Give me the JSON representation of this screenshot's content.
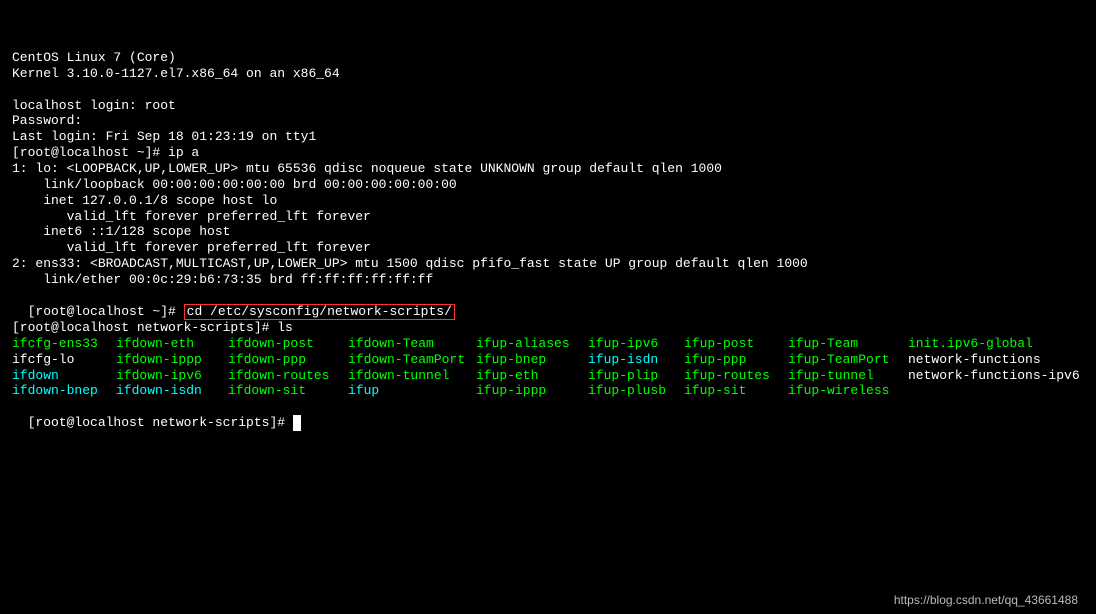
{
  "header": {
    "os": "CentOS Linux 7 (Core)",
    "kernel": "Kernel 3.10.0-1127.el7.x86_64 on an x86_64"
  },
  "login": {
    "prompt": "localhost login: root",
    "password": "Password:",
    "lastlogin": "Last login: Fri Sep 18 01:23:19 on tty1"
  },
  "cmd1": {
    "prompt": "[root@localhost ~]# ip a"
  },
  "ipa": {
    "l1": "1: lo: <LOOPBACK,UP,LOWER_UP> mtu 65536 qdisc noqueue state UNKNOWN group default qlen 1000",
    "l2": "    link/loopback 00:00:00:00:00:00 brd 00:00:00:00:00:00",
    "l3": "    inet 127.0.0.1/8 scope host lo",
    "l4": "       valid_lft forever preferred_lft forever",
    "l5": "    inet6 ::1/128 scope host",
    "l6": "       valid_lft forever preferred_lft forever",
    "l7": "2: ens33: <BROADCAST,MULTICAST,UP,LOWER_UP> mtu 1500 qdisc pfifo_fast state UP group default qlen 1000",
    "l8": "    link/ether 00:0c:29:b6:73:35 brd ff:ff:ff:ff:ff:ff"
  },
  "cmd2": {
    "prompt": "[root@localhost ~]# ",
    "boxed": "cd /etc/sysconfig/network-scripts/"
  },
  "cmd3": {
    "prompt": "[root@localhost network-scripts]# ls"
  },
  "ls": {
    "r0": {
      "c0": "ifcfg-ens33",
      "c1": "ifdown-eth",
      "c2": "ifdown-post",
      "c3": "ifdown-Team",
      "c4": "ifup-aliases",
      "c5": "ifup-ipv6",
      "c6": "ifup-post",
      "c7": "ifup-Team",
      "c8": "init.ipv6-global"
    },
    "r1": {
      "c0": "ifcfg-lo",
      "c1": "ifdown-ippp",
      "c2": "ifdown-ppp",
      "c3": "ifdown-TeamPort",
      "c4": "ifup-bnep",
      "c5": "ifup-isdn",
      "c6": "ifup-ppp",
      "c7": "ifup-TeamPort",
      "c8": "network-functions"
    },
    "r2": {
      "c0": "ifdown",
      "c1": "ifdown-ipv6",
      "c2": "ifdown-routes",
      "c3": "ifdown-tunnel",
      "c4": "ifup-eth",
      "c5": "ifup-plip",
      "c6": "ifup-routes",
      "c7": "ifup-tunnel",
      "c8": "network-functions-ipv6"
    },
    "r3": {
      "c0": "ifdown-bnep",
      "c1": "ifdown-isdn",
      "c2": "ifdown-sit",
      "c3": "ifup",
      "c4": "ifup-ippp",
      "c5": "ifup-plusb",
      "c6": "ifup-sit",
      "c7": "ifup-wireless",
      "c8": ""
    }
  },
  "cmd4": {
    "prompt": "[root@localhost network-scripts]# "
  },
  "watermark": "https://blog.csdn.net/qq_43661488"
}
